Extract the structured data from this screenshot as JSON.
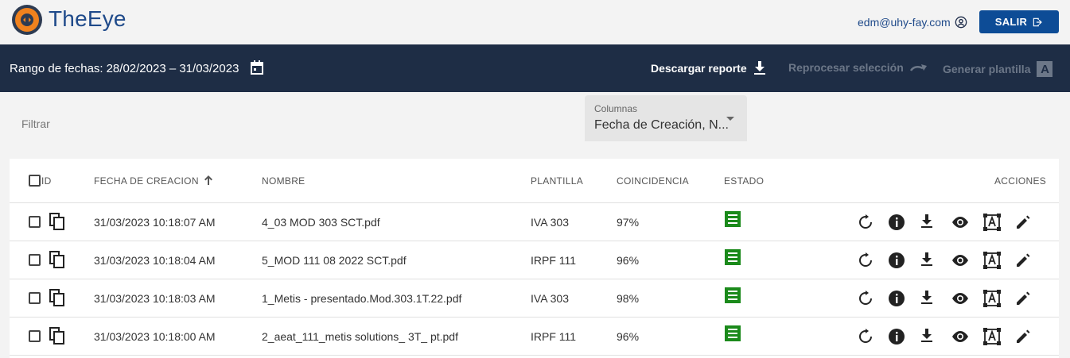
{
  "header": {
    "brand": "TheEye",
    "user_email": "edm@uhy-fay.com",
    "logout_label": "SALIR"
  },
  "toolbar": {
    "range_label": "Rango de fechas:",
    "range_value": "28/02/2023 – 31/03/2023",
    "download_label": "Descargar reporte",
    "reprocess_label": "Reprocesar selección",
    "template_label": "Generar plantilla",
    "template_badge": "A"
  },
  "filters": {
    "filter_placeholder": "Filtrar",
    "columns_label": "Columnas",
    "columns_value": "Fecha de Creación, N..."
  },
  "table": {
    "headers": {
      "id": "ID",
      "date": "FECHA DE CREACION",
      "name": "NOMBRE",
      "template": "PLANTILLA",
      "match": "COINCIDENCIA",
      "status": "ESTADO",
      "actions": "ACCIONES"
    },
    "sort_icon": "arrow-up-icon",
    "rows": [
      {
        "date": "31/03/2023 10:18:07 AM",
        "name": "4_03 MOD 303 SCT.pdf",
        "template": "IVA 303",
        "match": "97%",
        "status": "receipt-icon"
      },
      {
        "date": "31/03/2023 10:18:04 AM",
        "name": "5_MOD 111 08 2022 SCT.pdf",
        "template": "IRPF 111",
        "match": "96%",
        "status": "receipt-icon"
      },
      {
        "date": "31/03/2023 10:18:03 AM",
        "name": "1_Metis - presentado.Mod.303.1T.22.pdf",
        "template": "IVA 303",
        "match": "98%",
        "status": "receipt-icon"
      },
      {
        "date": "31/03/2023 10:18:00 AM",
        "name": "2_aeat_111_metis solutions_ 3T_ pt.pdf",
        "template": "IRPF 111",
        "match": "96%",
        "status": "receipt-icon"
      }
    ],
    "action_icons": [
      "reprocess-icon",
      "info-icon",
      "download-icon",
      "view-icon",
      "template-icon",
      "edit-icon"
    ]
  },
  "colors": {
    "brand_blue": "#1f4a8a",
    "button_blue": "#0d4c96",
    "toolbar_bg": "#1e2d45",
    "status_green": "#1b8a1b"
  }
}
